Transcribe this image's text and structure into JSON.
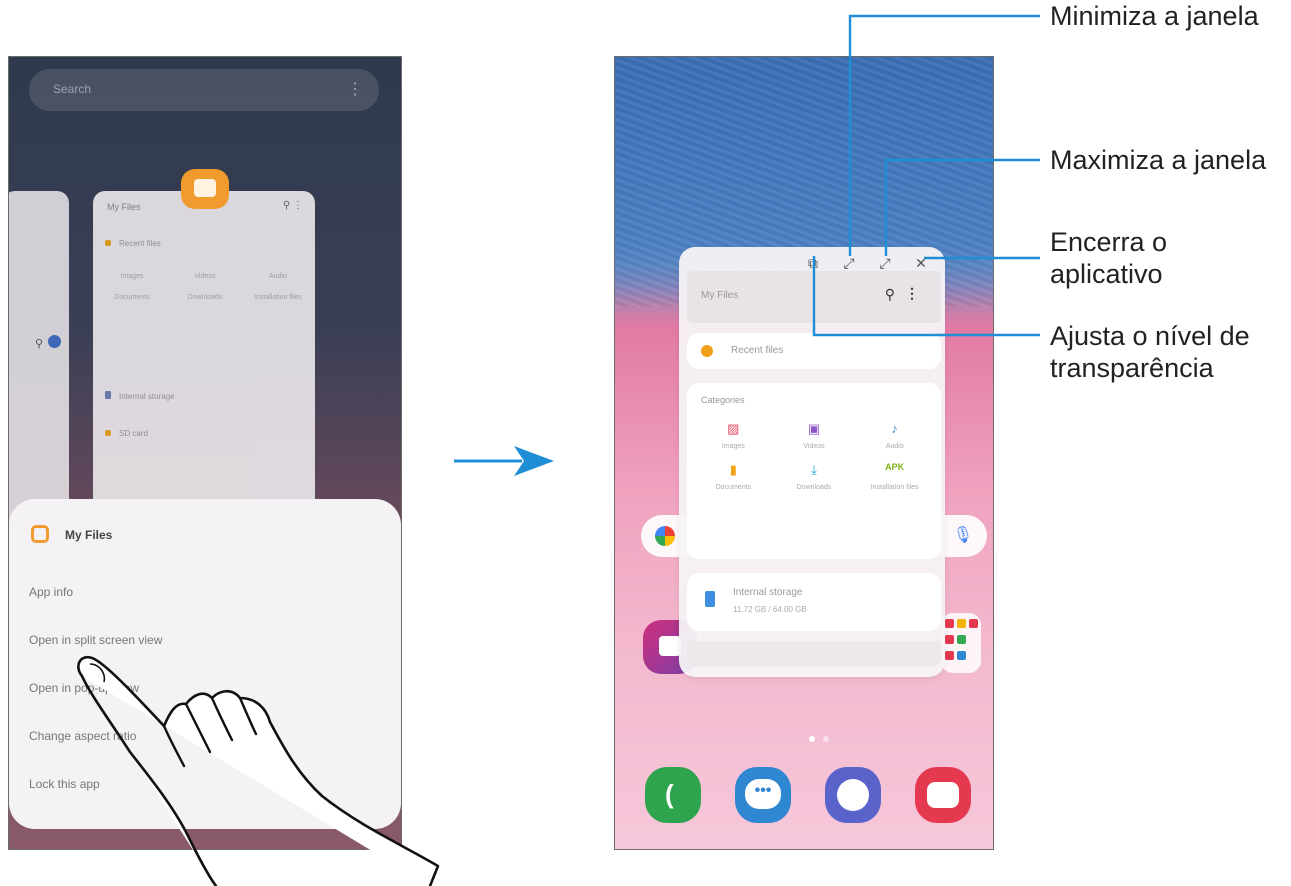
{
  "left_screen": {
    "search_placeholder": "Search",
    "card_title": "My Files",
    "card_rows": [
      "Recent files",
      "Internal storage",
      "SD card"
    ],
    "card_grid": [
      [
        "Images",
        "Videos",
        "Audio"
      ],
      [
        "Documents",
        "Downloads",
        "Installation files"
      ]
    ],
    "popup": {
      "app_name": "My Files",
      "menu": [
        "App info",
        "Open in split screen view",
        "Open in pop-up view",
        "Change aspect ratio",
        "Lock this app"
      ]
    }
  },
  "right_screen": {
    "popup_window": {
      "title": "My Files",
      "recent_label": "Recent files",
      "categories_label": "Categories",
      "categories": [
        {
          "icon": "image-icon",
          "label": "Images"
        },
        {
          "icon": "video-icon",
          "label": "Videos"
        },
        {
          "icon": "audio-icon",
          "label": "Audio"
        },
        {
          "icon": "document-icon",
          "label": "Documents"
        },
        {
          "icon": "download-icon",
          "label": "Downloads"
        },
        {
          "icon": "apk-icon",
          "label": "Installation files"
        }
      ],
      "storage_label": "Internal storage",
      "storage_usage": "11.72 GB / 64.00 GB",
      "controls": {
        "transparency": "⧉",
        "minimize": "⤢",
        "maximize": "⤢",
        "close": "✕"
      }
    },
    "dock_icons": [
      "phone-icon",
      "messages-icon",
      "internet-icon",
      "camera-icon"
    ],
    "colors": {
      "phone": "#2fa44f",
      "messages": "#2f86d1",
      "internet": "#5a63c9",
      "camera": "#e53950"
    }
  },
  "callouts": {
    "minimize": "Minimiza a janela",
    "maximize": "Maximiza a janela",
    "close_line1": "Encerra o",
    "close_line2": "aplicativo",
    "transparency_line1": "Ajusta o nível de",
    "transparency_line2": "transparência"
  },
  "accent": "#1f8ed6"
}
